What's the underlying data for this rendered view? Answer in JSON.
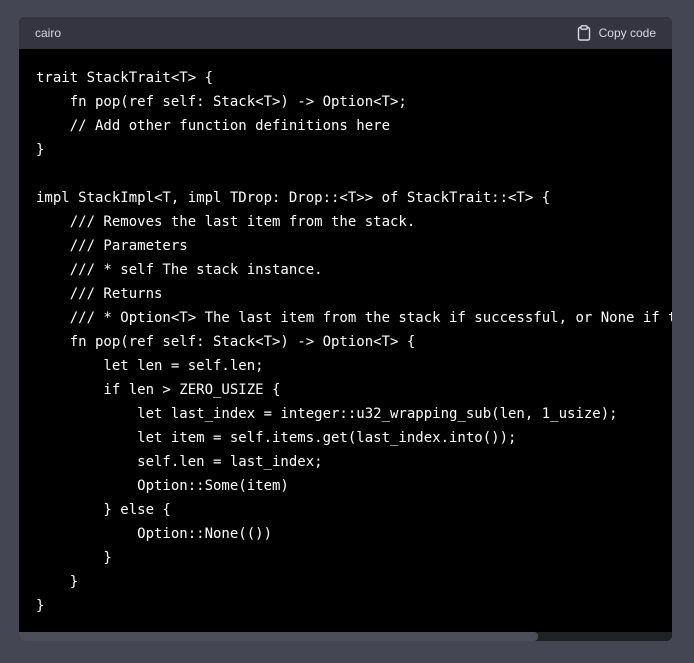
{
  "code_block": {
    "language": "cairo",
    "copy_label": "Copy code",
    "copy_icon": "clipboard-icon",
    "lines": [
      "trait StackTrait<T> {",
      "    fn pop(ref self: Stack<T>) -> Option<T>;",
      "    // Add other function definitions here",
      "}",
      "",
      "impl StackImpl<T, impl TDrop: Drop::<T>> of StackTrait::<T> {",
      "    /// Removes the last item from the stack.",
      "    /// Parameters",
      "    /// * self The stack instance.",
      "    /// Returns",
      "    /// * Option<T> The last item from the stack if successful, or None if the stack is empty.",
      "    fn pop(ref self: Stack<T>) -> Option<T> {",
      "        let len = self.len;",
      "        if len > ZERO_USIZE {",
      "            let last_index = integer::u32_wrapping_sub(len, 1_usize);",
      "            let item = self.items.get(last_index.into());",
      "            self.len = last_index;",
      "            Option::Some(item)",
      "        } else {",
      "            Option::None(())",
      "        }",
      "    }",
      "}"
    ],
    "horizontal_scroll_position": 0.0,
    "horizontal_scroll_visible_fraction": 0.79
  }
}
